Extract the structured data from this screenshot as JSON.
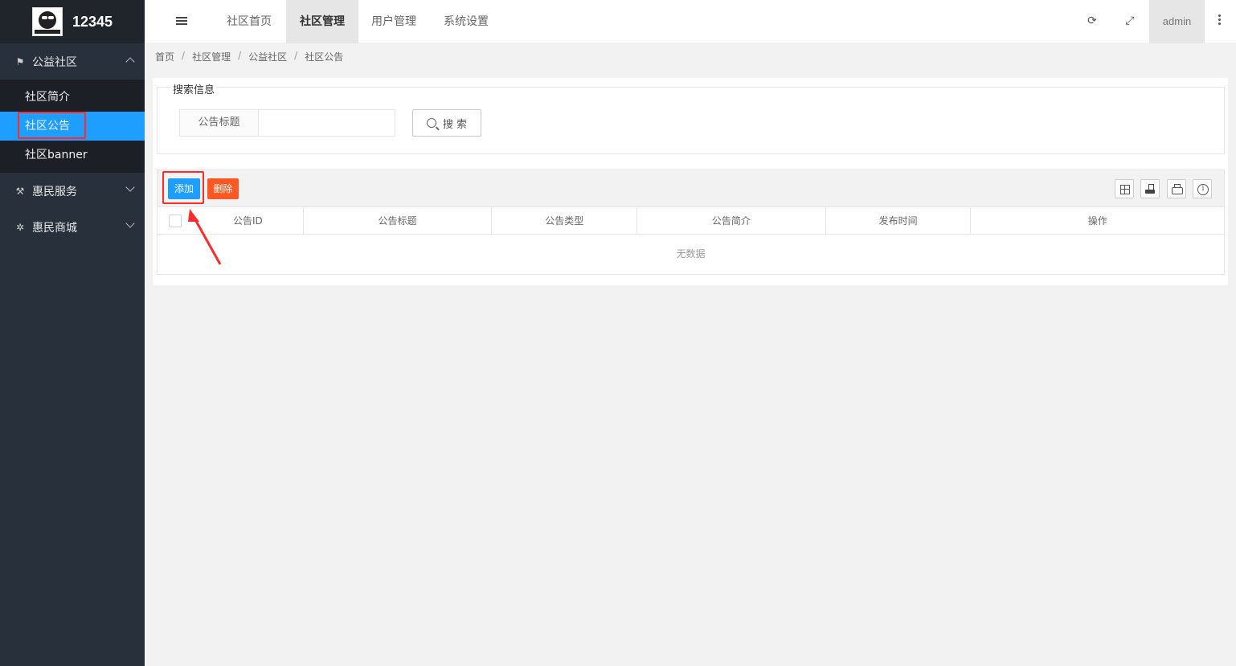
{
  "app": {
    "name": "12345"
  },
  "sidebar": {
    "groups": [
      {
        "label": "公益社区",
        "icon": "flag-icon",
        "expanded": true,
        "items": [
          {
            "label": "社区简介"
          },
          {
            "label": "社区公告",
            "active": true
          },
          {
            "label": "社区banner"
          }
        ]
      },
      {
        "label": "惠民服务",
        "icon": "wrench-icon",
        "expanded": false
      },
      {
        "label": "惠民商城",
        "icon": "cluster-icon",
        "expanded": false
      }
    ]
  },
  "header": {
    "tabs": [
      {
        "label": "社区首页"
      },
      {
        "label": "社区管理",
        "active": true
      },
      {
        "label": "用户管理"
      },
      {
        "label": "系统设置"
      }
    ],
    "user": "admin",
    "icons": [
      "menu-toggle-icon",
      "refresh-icon",
      "fullscreen-icon",
      "more-vertical-icon"
    ]
  },
  "breadcrumb": [
    "首页",
    "社区管理",
    "公益社区",
    "社区公告"
  ],
  "search": {
    "legend": "搜索信息",
    "field_label": "公告标题",
    "value": "",
    "placeholder": "",
    "button": "搜 索"
  },
  "toolbar": {
    "add": "添加",
    "delete": "删除",
    "icons": [
      "columns-icon",
      "export-icon",
      "print-icon",
      "info-icon"
    ]
  },
  "table": {
    "columns": [
      "公告ID",
      "公告标题",
      "公告类型",
      "公告简介",
      "发布时间",
      "操作"
    ],
    "rows": [],
    "empty_text": "无数据"
  },
  "colors": {
    "sidebar_bg": "#28303b",
    "active_blue": "#1e9fff",
    "danger_orange": "#ff5722",
    "annotation_red": "#ff2a2a"
  }
}
